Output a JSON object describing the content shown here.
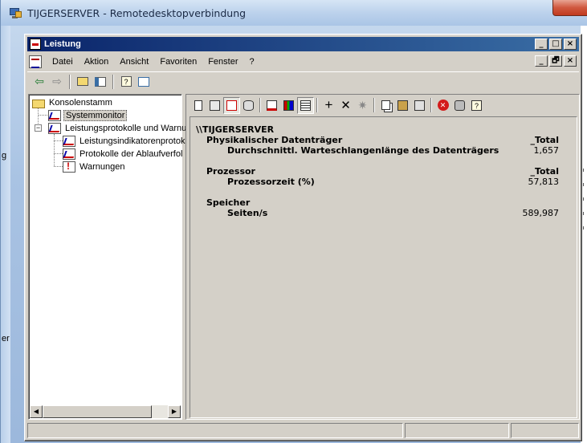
{
  "rdp_window": {
    "title": "TIJGERSERVER - Remotedesktopverbindung",
    "side_text_left": [
      "g",
      "er"
    ]
  },
  "mmc_window": {
    "title": "Leistung",
    "menu": [
      {
        "label": "Datei"
      },
      {
        "label": "Aktion"
      },
      {
        "label": "Ansicht"
      },
      {
        "label": "Favoriten"
      },
      {
        "label": "Fenster"
      },
      {
        "label": "?"
      }
    ],
    "caption_buttons": [
      "_",
      "□",
      "×"
    ],
    "doc_buttons": [
      "_",
      "🗗",
      "×"
    ]
  },
  "tree": {
    "root": "Konsolenstamm",
    "items": [
      {
        "label": "Systemmonitor",
        "selected": true
      },
      {
        "label": "Leistungsprotokolle und Warnu",
        "expanded": true
      },
      {
        "label": "Leistungsindikatorenprotok"
      },
      {
        "label": "Protokolle der Ablaufverfol"
      },
      {
        "label": "Warnungen"
      }
    ]
  },
  "report": {
    "server": "\\\\TIJGERSERVER",
    "objects": [
      {
        "name": "Physikalischer Datenträger",
        "instance": "_Total",
        "counter": "Durchschnittl. Warteschlangenlänge des Datenträgers",
        "value": "1,657"
      },
      {
        "name": "Prozessor",
        "instance": "_Total",
        "counter": "Prozessorzeit (%)",
        "value": "57,813"
      },
      {
        "name": "Speicher",
        "instance": "",
        "counter": "Seiten/s",
        "value": "589,987"
      }
    ]
  }
}
